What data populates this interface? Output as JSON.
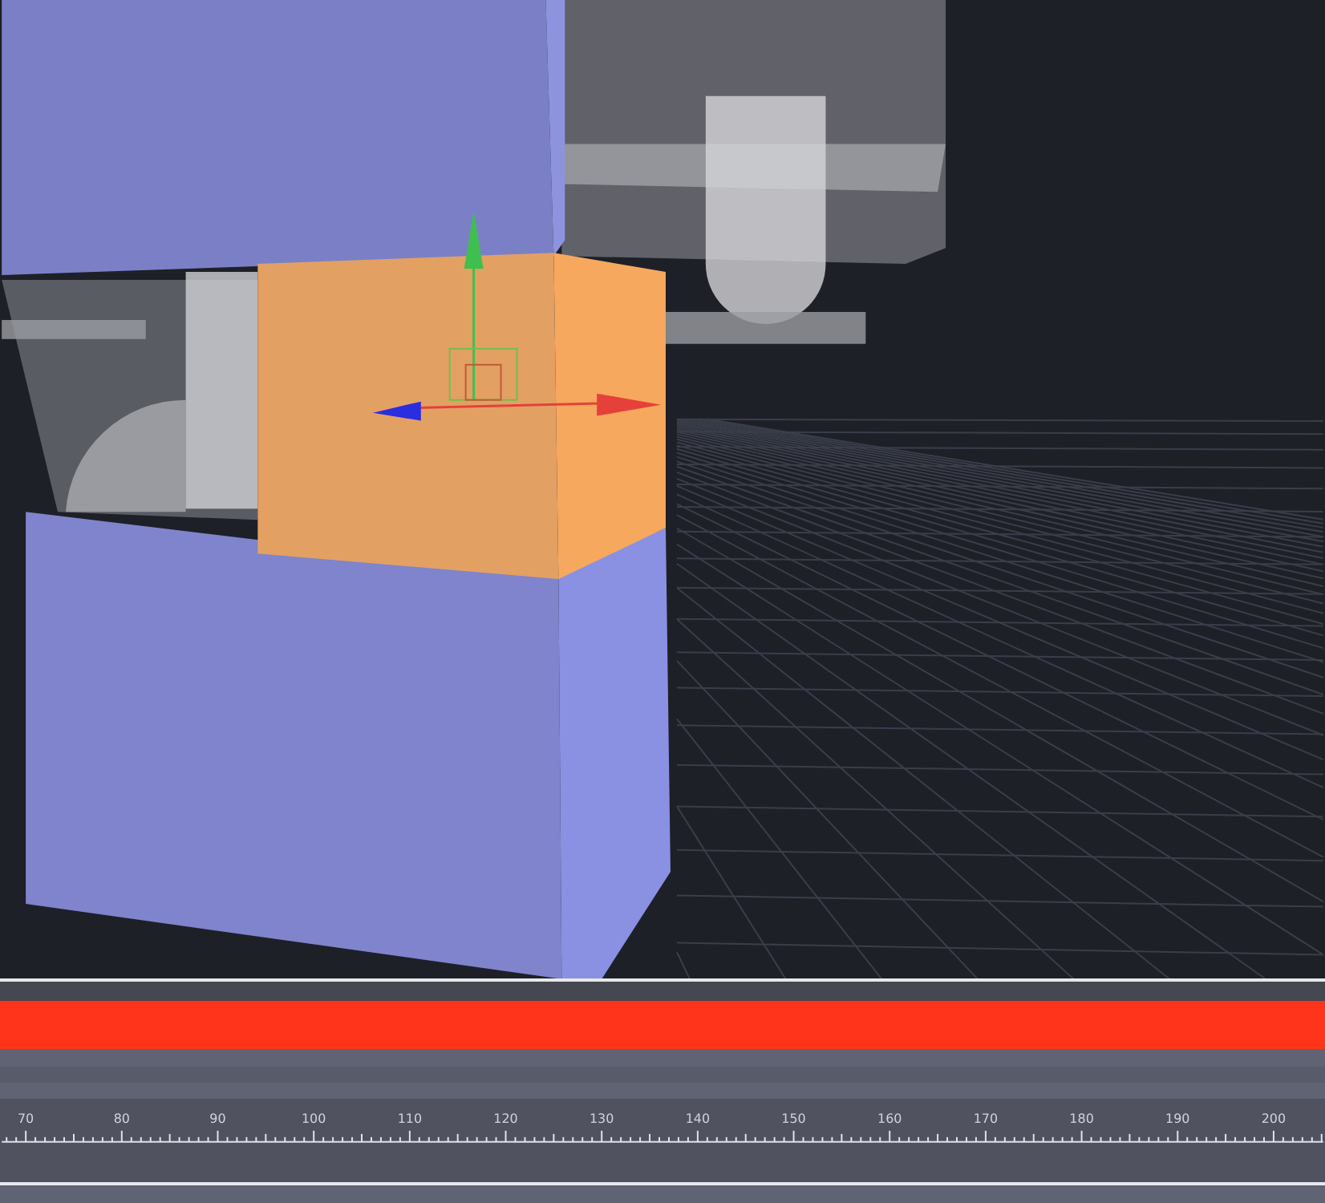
{
  "viewport": {
    "cube_selected": true
  },
  "timeline": {
    "ruler_labels": [
      "70",
      "80",
      "90",
      "100",
      "110",
      "120",
      "130",
      "140",
      "150",
      "160",
      "170",
      "180",
      "190",
      "200"
    ]
  }
}
